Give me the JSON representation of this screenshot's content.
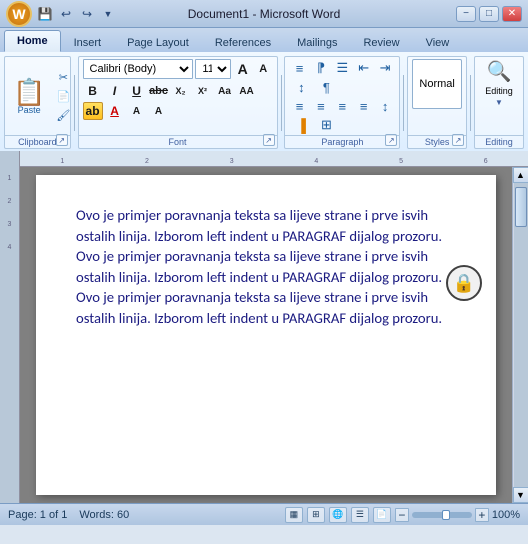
{
  "titlebar": {
    "title": "Document1 - Microsoft Word",
    "minimize": "−",
    "restore": "□",
    "close": "✕"
  },
  "qat": {
    "save": "💾",
    "undo": "↩",
    "redo": "↪",
    "more": "▼"
  },
  "tabs": [
    {
      "id": "home",
      "label": "Home",
      "active": true
    },
    {
      "id": "insert",
      "label": "Insert",
      "active": false
    },
    {
      "id": "pagelayout",
      "label": "Page Layout",
      "active": false
    },
    {
      "id": "references",
      "label": "References",
      "active": false
    },
    {
      "id": "mailings",
      "label": "Mailings",
      "active": false
    },
    {
      "id": "review",
      "label": "Review",
      "active": false
    },
    {
      "id": "view",
      "label": "View",
      "active": false
    }
  ],
  "ribbon": {
    "clipboard": {
      "label": "Clipboard",
      "paste": "Paste"
    },
    "font": {
      "label": "Font",
      "name": "Calibri (Body)",
      "size": "11"
    },
    "paragraph": {
      "label": "Paragraph"
    },
    "styles": {
      "label": "Styles"
    },
    "editing": {
      "label": "Editing"
    }
  },
  "document": {
    "text": "Ovo je primjer poravnanja teksta sa lijeve strane i prve isvih ostalih linija. Izborom left indent u PARAGRAF dijalog prozoru. Ovo je primjer poravnanja teksta sa lijeve strane i prve isvih ostalih linija. Izborom left indent u PARAGRAF dijalog prozoru. Ovo je primjer poravnanja teksta sa lijeve strane i prve isvih ostalih linija. Izborom left indent u PARAGRAF dijalog prozoru."
  },
  "statusbar": {
    "page": "Page: 1 of 1",
    "words": "Words: 60",
    "zoom": "100%"
  }
}
